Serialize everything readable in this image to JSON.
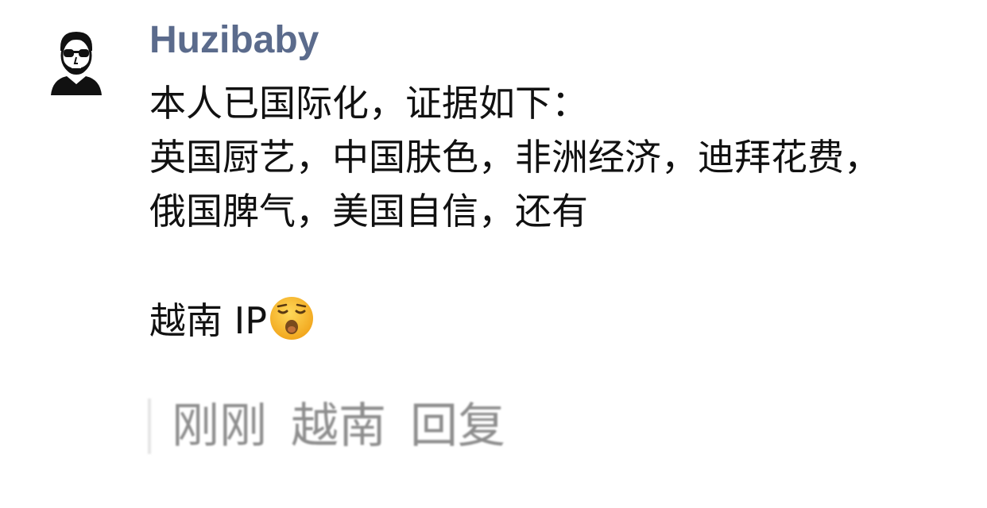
{
  "comment": {
    "username": "Huzibaby",
    "lines": [
      "本人已国际化，证据如下：",
      "英国厨艺，中国肤色，非洲经济，迪拜花费，",
      "俄国脾气，美国自信，还有"
    ],
    "ip_text": "越南 IP",
    "emoji": "sleeping-face-emoji",
    "footer": {
      "time": "刚刚",
      "location": "越南",
      "reply_label": "回复"
    }
  },
  "icons": {
    "avatar": "man-with-sunglasses-avatar-icon"
  }
}
